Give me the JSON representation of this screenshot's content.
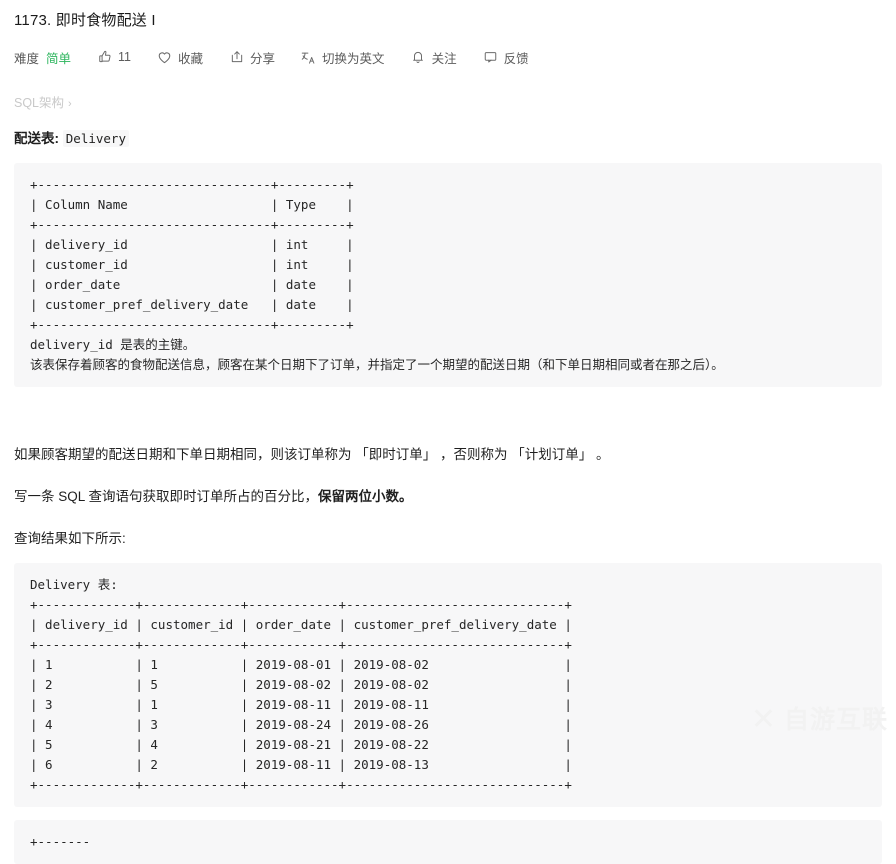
{
  "problem": {
    "title": "1173. 即时食物配送 I",
    "difficulty_label": "难度",
    "difficulty_value": "简单",
    "difficulty_color": "#2db55d"
  },
  "toolbar": {
    "like": {
      "icon": "thumbs-up-icon",
      "count": "11"
    },
    "favorite": {
      "icon": "heart-icon",
      "label": "收藏"
    },
    "share": {
      "icon": "share-icon",
      "label": "分享"
    },
    "translate": {
      "icon": "translate-icon",
      "label": "切换为英文"
    },
    "subscribe": {
      "icon": "bell-icon",
      "label": "关注"
    },
    "feedback": {
      "icon": "feedback-icon",
      "label": "反馈"
    }
  },
  "breadcrumb": {
    "label": "SQL架构",
    "chevron": "›"
  },
  "schema": {
    "heading_prefix": "配送表:",
    "heading_table": "Delivery",
    "code": "+-------------------------------+---------+\n| Column Name                   | Type    |\n+-------------------------------+---------+\n| delivery_id                   | int     |\n| customer_id                   | int     |\n| order_date                    | date    |\n| customer_pref_delivery_date   | date    |\n+-------------------------------+---------+\ndelivery_id 是表的主键。\n该表保存着顾客的食物配送信息，顾客在某个日期下了订单，并指定了一个期望的配送日期（和下单日期相同或者在那之后）。"
  },
  "description": {
    "p1": "如果顾客期望的配送日期和下单日期相同，则该订单称为 「即时订单」 ，否则称为 「计划订单」 。",
    "p2_before": "写一条 SQL 查询语句获取即时订单所占的百分比，",
    "p2_bold": "保留两位小数。",
    "p3": "查询结果如下所示:"
  },
  "example": {
    "code": "Delivery 表:\n+-------------+-------------+------------+-----------------------------+\n| delivery_id | customer_id | order_date | customer_pref_delivery_date |\n+-------------+-------------+------------+-----------------------------+\n| 1           | 1           | 2019-08-01 | 2019-08-02                  |\n| 2           | 5           | 2019-08-02 | 2019-08-02                  |\n| 3           | 1           | 2019-08-11 | 2019-08-11                  |\n| 4           | 3           | 2019-08-24 | 2019-08-26                  |\n| 5           | 4           | 2019-08-21 | 2019-08-22                  |\n| 6           | 2           | 2019-08-11 | 2019-08-13                  |\n+-------------+-------------+------------+-----------------------------+"
  },
  "next_block": {
    "partial_code": "+-------"
  },
  "watermark": {
    "mark": "✕",
    "text": "自游互联"
  }
}
